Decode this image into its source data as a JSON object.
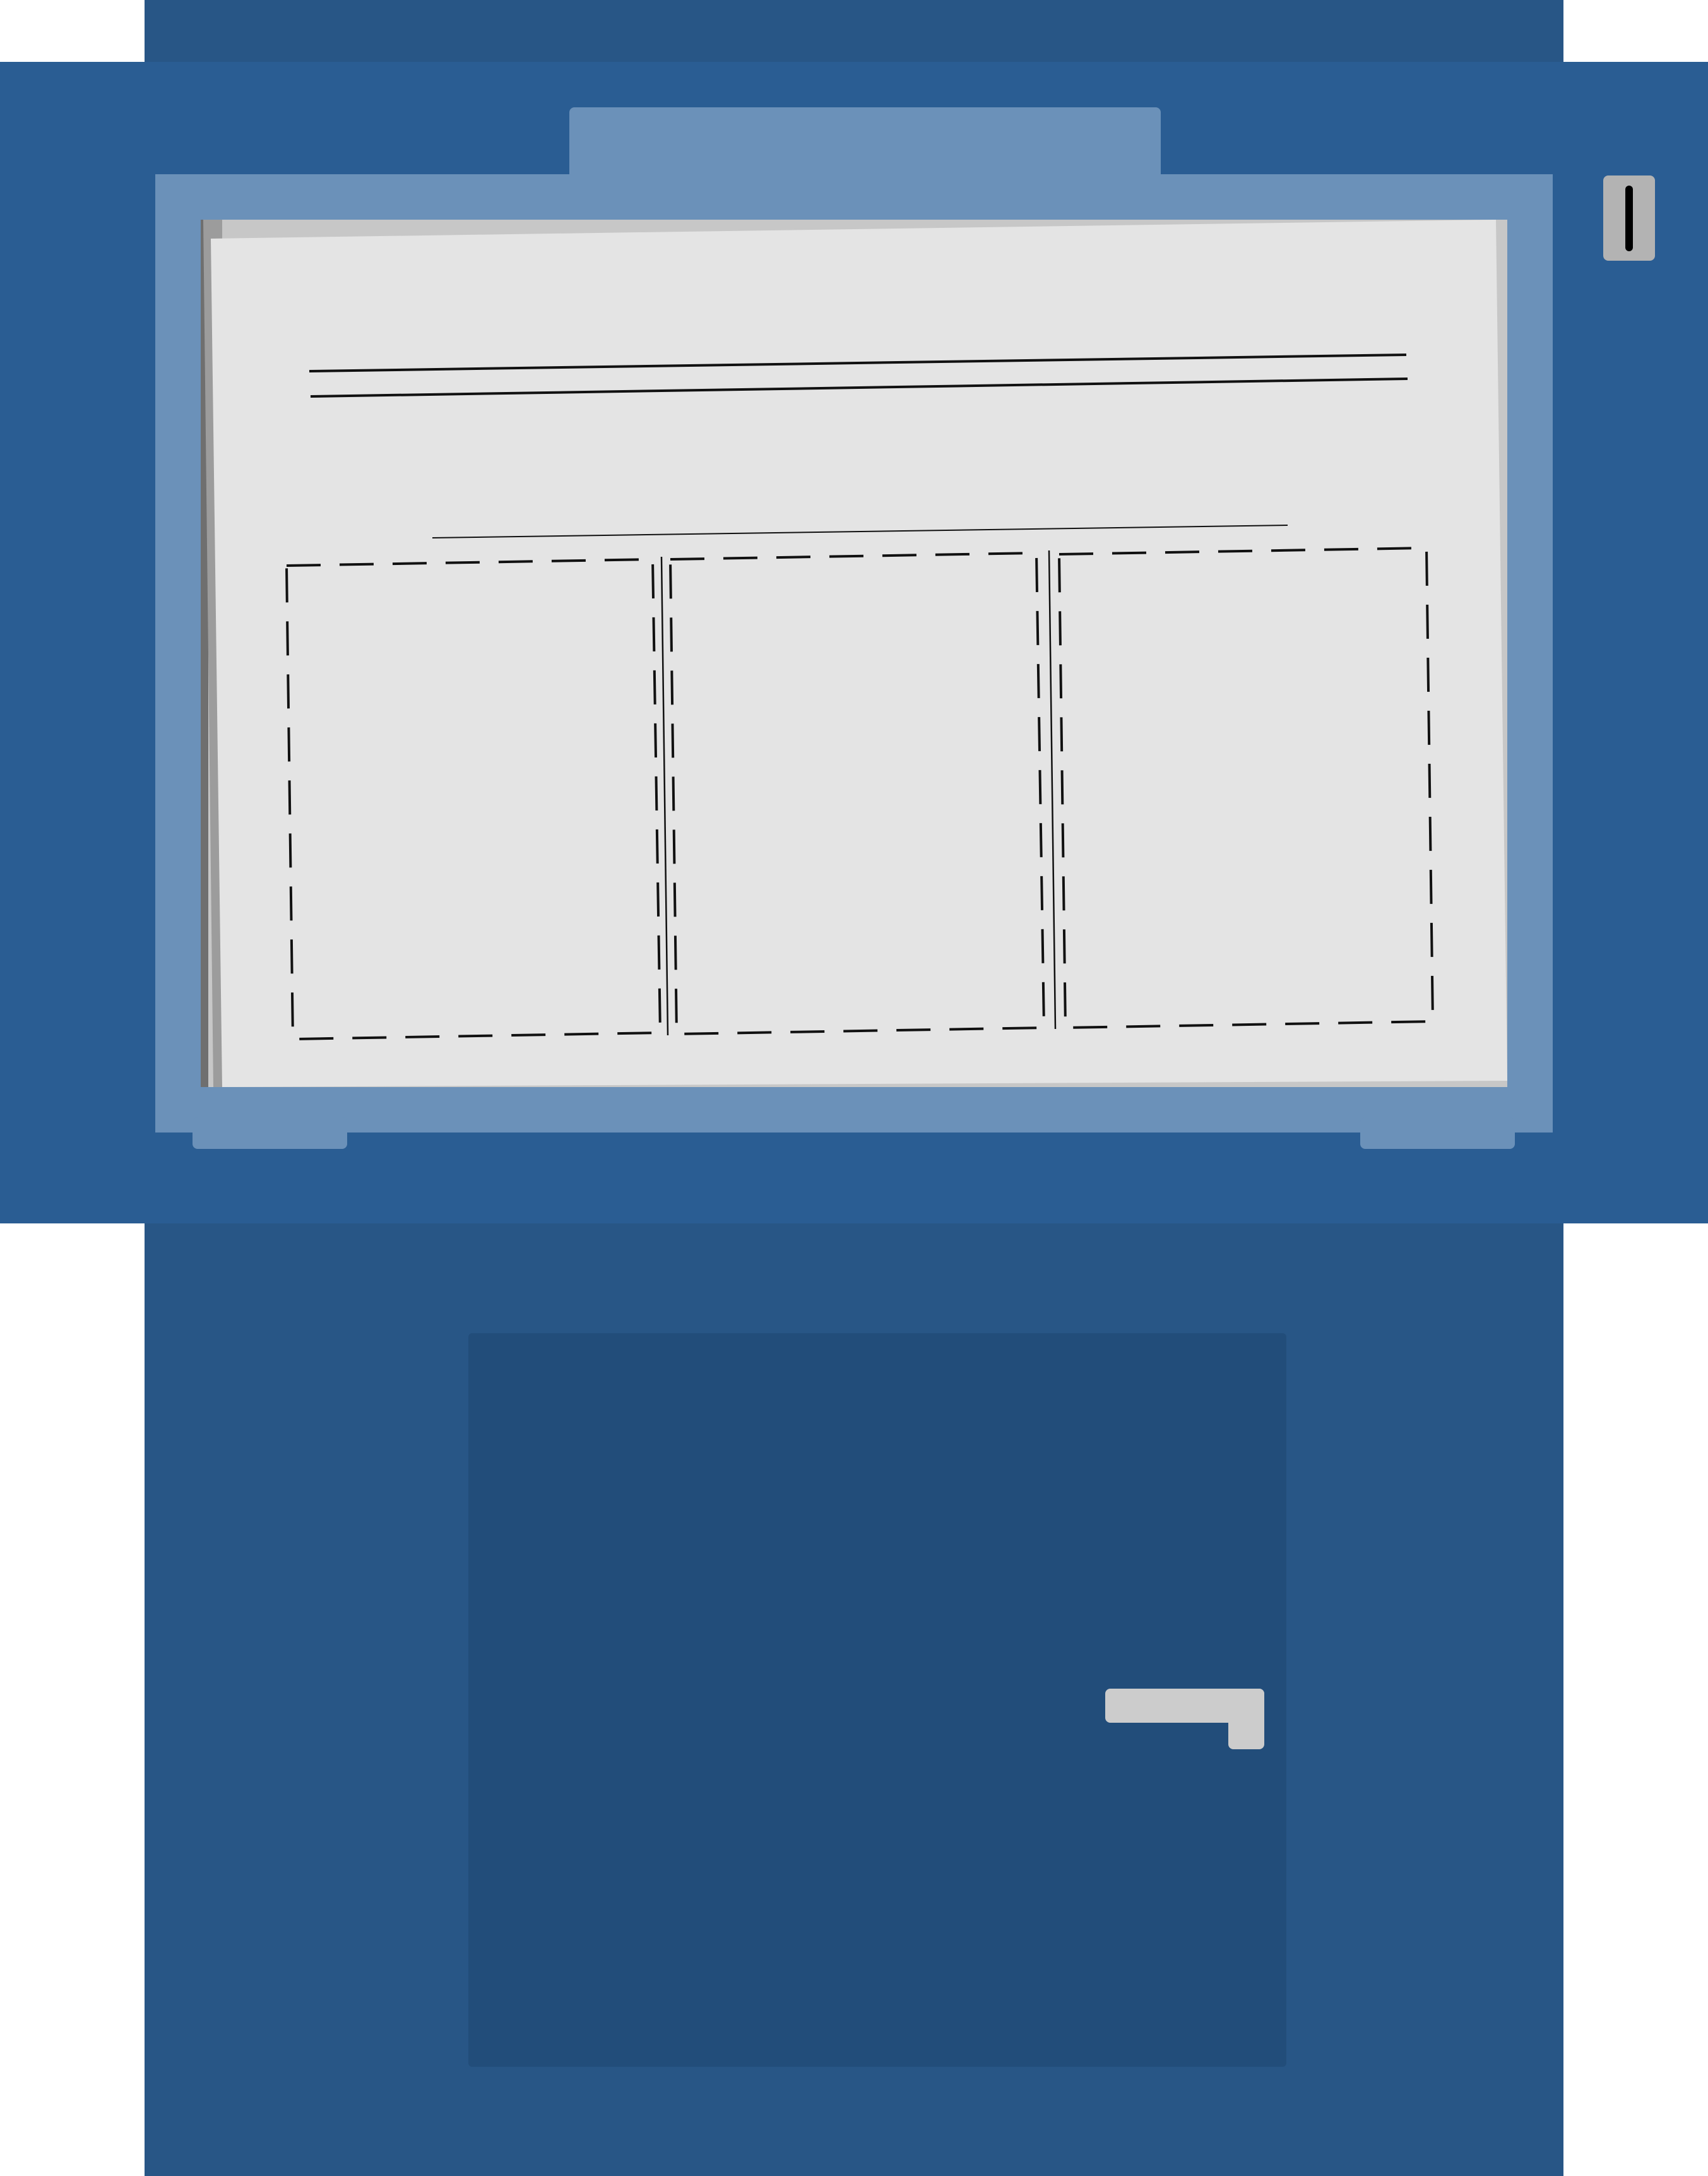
{
  "illustration": {
    "kind": "newspaper vending box",
    "colors": {
      "background": "#ffffff",
      "cabinet": "#285686",
      "upper_housing": "#2a5d93",
      "window_frame": "#6b91b9",
      "newspaper_page": "#e4e4e4",
      "page_shadow": "#c7c7c7",
      "page_edge_dark": "#6f6f6f",
      "page_edge_mid": "#9c9c9c",
      "ink": "#111111",
      "door": "#224d7a",
      "handle": "#cccccc",
      "coin_slot_plate": "#b3b3b3",
      "coin_slot": "#000000"
    },
    "newspaper": {
      "masthead_rules": 2,
      "subhead_rules": 1,
      "columns": 3,
      "column_style": "dashed-outline"
    },
    "icons": {
      "coin_slot": "coin-slot-icon",
      "door_handle": "door-handle-icon"
    }
  }
}
